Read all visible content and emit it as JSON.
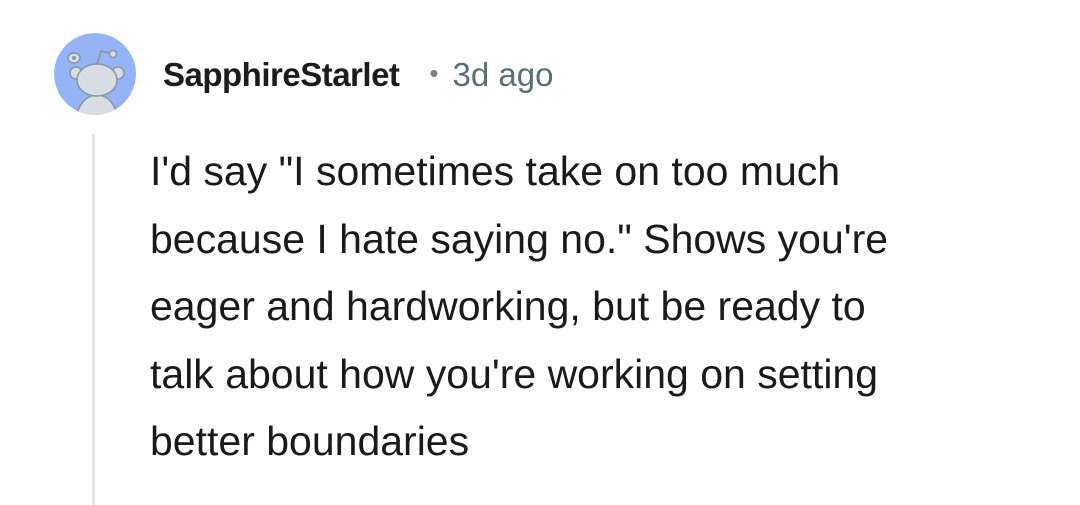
{
  "comment": {
    "username": "SapphireStarlet",
    "separator": "•",
    "timestamp": "3d ago",
    "avatar_icon": "reddit-snoo-avatar-icon",
    "body_lines": [
      "I'd say \"I sometimes take on too much",
      "because I hate saying no.\" Shows you're",
      "eager and hardworking, but be ready to",
      "talk about how you're working on setting",
      "better boundaries"
    ]
  },
  "colors": {
    "avatar_bg": "#94b4f7",
    "avatar_figure": "#d6dde3",
    "thread_line": "#e4e6e8",
    "username": "#1c1c1c",
    "timestamp": "#576f76",
    "body_text": "#1a1a1b"
  }
}
